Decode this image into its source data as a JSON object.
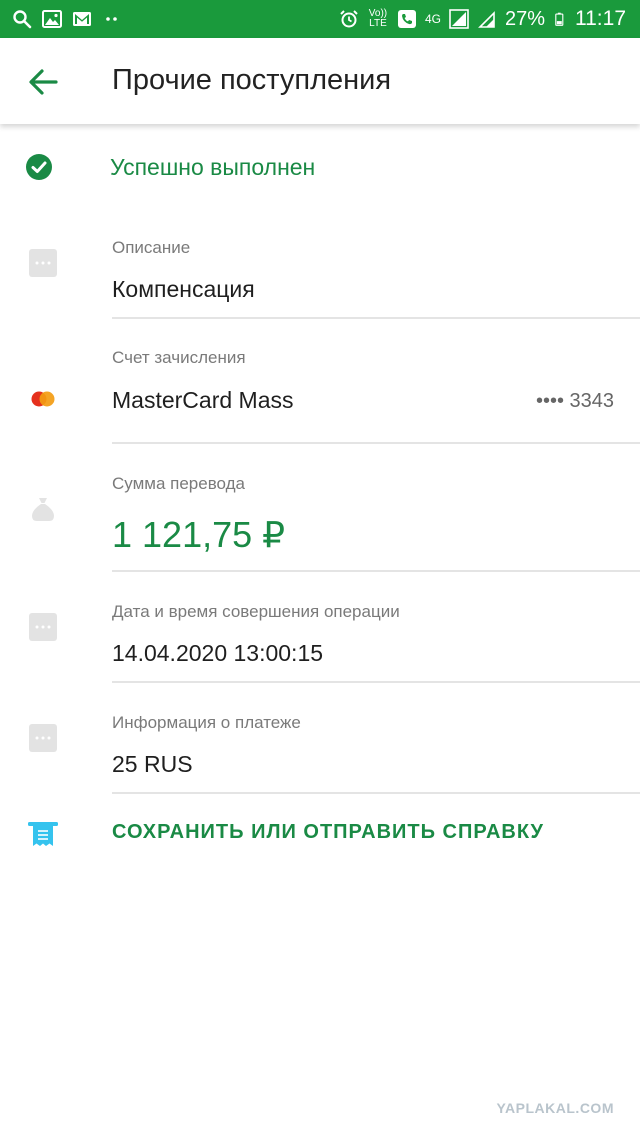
{
  "status_bar": {
    "volte": "Vo)) LTE",
    "network": "4G",
    "battery": "27%",
    "time": "11:17"
  },
  "appbar": {
    "title": "Прочие поступления"
  },
  "status": {
    "text": "Успешно выполнен",
    "color": "#1a8a45"
  },
  "fields": {
    "description": {
      "label": "Описание",
      "value": "Компенсация"
    },
    "account": {
      "label": "Счет зачисления",
      "value": "MasterCard Mass",
      "mask": "•••• 3343"
    },
    "amount": {
      "label": "Сумма перевода",
      "value": "1 121,75 ₽"
    },
    "datetime": {
      "label": "Дата и время совершения операции",
      "value": "14.04.2020 13:00:15"
    },
    "payment_info": {
      "label": "Информация о платеже",
      "value": "25 RUS"
    }
  },
  "action": {
    "label": "СОХРАНИТЬ ИЛИ ОТПРАВИТЬ СПРАВКУ"
  },
  "watermark": "YAPLAKAL.COM",
  "colors": {
    "brand_green": "#1a9a3c",
    "accent_green": "#1a8a45",
    "receipt_blue": "#35c3ee"
  }
}
